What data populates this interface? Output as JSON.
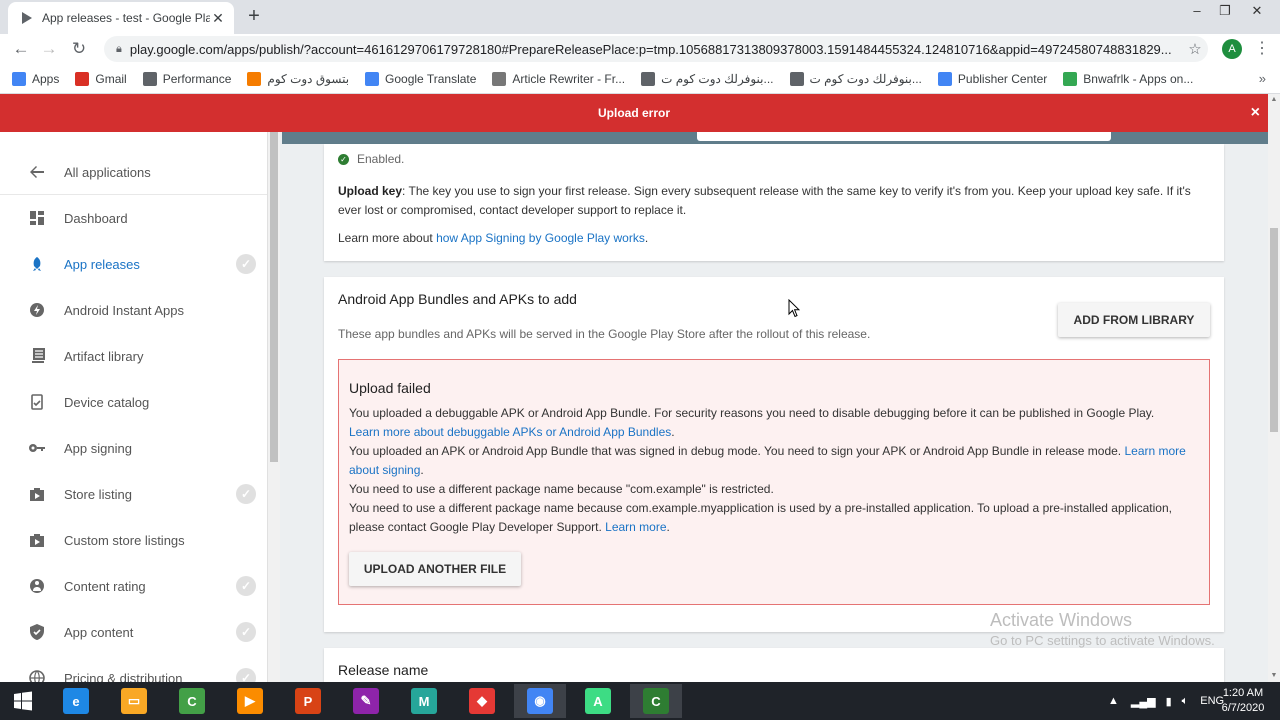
{
  "browser": {
    "tab_title": "App releases - test - Google Play",
    "url": "play.google.com/apps/publish/?account=4616129706179728180#PrepareReleasePlace:p=tmp.10568817313809378003.1591484455324.124810716&appid=49724580748831829...",
    "avatar_letter": "A",
    "bookmarks": [
      {
        "label": "Apps",
        "icon": "apps-grid-icon",
        "color": "#4285f4"
      },
      {
        "label": "Gmail",
        "icon": "gmail-icon",
        "color": "#d93025"
      },
      {
        "label": "Performance",
        "icon": "performance-icon",
        "color": "#5f6368"
      },
      {
        "label": "بتسوق دوت كوم",
        "icon": "blogger-icon",
        "color": "#f57c00"
      },
      {
        "label": "Google Translate",
        "icon": "translate-icon",
        "color": "#4285f4"
      },
      {
        "label": "Article Rewriter - Fr...",
        "icon": "sst-icon",
        "color": "#777777"
      },
      {
        "label": "بنوفرلك دوت كوم ت...",
        "icon": "page-icon",
        "color": "#5f6368"
      },
      {
        "label": "بنوفرلك دوت كوم ت...",
        "icon": "page-icon",
        "color": "#5f6368"
      },
      {
        "label": "Publisher Center",
        "icon": "google-g-icon",
        "color": "#4285f4"
      },
      {
        "label": "Bnwafrlk - Apps on...",
        "icon": "google-play-icon",
        "color": "#34a853"
      }
    ],
    "bookmarks_more": "»"
  },
  "error_bar": {
    "text": "Upload error",
    "close": "×"
  },
  "sidebar": {
    "items": [
      {
        "label": "All applications",
        "icon": "arrow-back-icon",
        "check": false,
        "active": false
      },
      {
        "label": "Dashboard",
        "icon": "dashboard-icon",
        "check": false,
        "active": false
      },
      {
        "label": "App releases",
        "icon": "rocket-icon",
        "check": true,
        "active": true
      },
      {
        "label": "Android Instant Apps",
        "icon": "instant-apps-icon",
        "check": false,
        "active": false
      },
      {
        "label": "Artifact library",
        "icon": "artifact-library-icon",
        "check": false,
        "active": false
      },
      {
        "label": "Device catalog",
        "icon": "device-catalog-icon",
        "check": false,
        "active": false
      },
      {
        "label": "App signing",
        "icon": "key-icon",
        "check": false,
        "active": false
      },
      {
        "label": "Store listing",
        "icon": "store-listing-icon",
        "check": true,
        "active": false
      },
      {
        "label": "Custom store listings",
        "icon": "custom-store-icon",
        "check": false,
        "active": false
      },
      {
        "label": "Content rating",
        "icon": "content-rating-icon",
        "check": true,
        "active": false
      },
      {
        "label": "App content",
        "icon": "shield-check-icon",
        "check": true,
        "active": false
      },
      {
        "label": "Pricing & distribution",
        "icon": "globe-icon",
        "check": true,
        "active": false
      }
    ]
  },
  "signing_card": {
    "enabled_text": "Enabled.",
    "upload_key_label": "Upload key",
    "upload_key_text": ": The key you use to sign your first release. Sign every subsequent release with the same key to verify it's from you. Keep your upload key safe. If it's ever lost or compromised, contact developer support to replace it.",
    "learn_prefix": "Learn more about ",
    "learn_link": "how App Signing by Google Play works",
    "learn_suffix": "."
  },
  "bundles_card": {
    "title": "Android App Bundles and APKs to add",
    "description": "These app bundles and APKs will be served in the Google Play Store after the rollout of this release.",
    "add_button": "ADD FROM LIBRARY",
    "upload_failed": {
      "title": "Upload failed",
      "line1": "You uploaded a debuggable APK or Android App Bundle. For security reasons you need to disable debugging before it can be published in Google Play.",
      "line1_link": "Learn more about debuggable APKs or Android App Bundles",
      "line1_suffix": ".",
      "line2": "You uploaded an APK or Android App Bundle that was signed in debug mode. You need to sign your APK or Android App Bundle in release mode. ",
      "line2_link": "Learn more about signing",
      "line2_suffix": ".",
      "line3": "You need to use a different package name because \"com.example\" is restricted.",
      "line4": "You need to use a different package name because com.example.myapplication is used by a pre-installed application. To upload a pre-installed application, please contact Google Play Developer Support. ",
      "line4_link": "Learn more",
      "line4_suffix": ".",
      "upload_button": "UPLOAD ANOTHER FILE"
    }
  },
  "release_card": {
    "title": "Release name"
  },
  "watermark": {
    "line1": "Activate Windows",
    "line2": "Go to PC settings to activate Windows."
  },
  "taskbar": {
    "apps": [
      {
        "name": "internet-explorer-icon",
        "glyph": "e",
        "color": "#1e88e5"
      },
      {
        "name": "file-explorer-icon",
        "glyph": "▭",
        "color": "#f9a825"
      },
      {
        "name": "camtasia-icon",
        "glyph": "C",
        "color": "#43a047"
      },
      {
        "name": "media-player-icon",
        "glyph": "▶",
        "color": "#fb8c00"
      },
      {
        "name": "powerpoint-icon",
        "glyph": "P",
        "color": "#d84315"
      },
      {
        "name": "paint-icon",
        "glyph": "✎",
        "color": "#8e24aa"
      },
      {
        "name": "maya-icon",
        "glyph": "M",
        "color": "#26a69a"
      },
      {
        "name": "tool-icon",
        "glyph": "◆",
        "color": "#e53935"
      },
      {
        "name": "chrome-icon",
        "glyph": "◉",
        "color": "#4285f4"
      },
      {
        "name": "android-studio-icon",
        "glyph": "A",
        "color": "#3ddc84"
      },
      {
        "name": "camtasia-recorder-icon",
        "glyph": "C",
        "color": "#2e7d32"
      }
    ],
    "lang": "ENG",
    "time": "1:20 AM",
    "date": "6/7/2020"
  }
}
